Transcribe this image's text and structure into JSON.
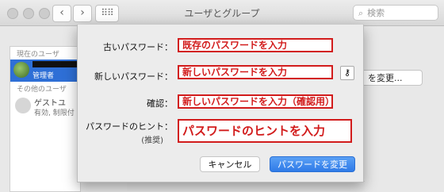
{
  "window": {
    "title": "ユーザとグループ",
    "search_placeholder": "検索"
  },
  "nav": {
    "back": "‹",
    "forward": "›",
    "grid": "⠿⠿"
  },
  "sidebar": {
    "current_user_header": "現在のユーザ",
    "admin_label": "管理者",
    "other_users_header": "その他のユーザ",
    "guest_name": "ゲストユ",
    "guest_status": "有効, 制限付"
  },
  "behind": {
    "change_button": "を変更..."
  },
  "sheet": {
    "old_label": "古いパスワード：",
    "new_label": "新しいパスワード：",
    "confirm_label": "確認：",
    "hint_label": "パスワードのヒント：",
    "hint_recommended": "(推奨)",
    "old_value": "既存のパスワードを入力",
    "new_value": "新しいパスワードを入力",
    "confirm_value": "新しいパスワードを入力（確認用）",
    "hint_value": "パスワードのヒントを入力",
    "key_icon": "⚷",
    "cancel_button": "キャンセル",
    "change_button": "パスワードを変更"
  }
}
